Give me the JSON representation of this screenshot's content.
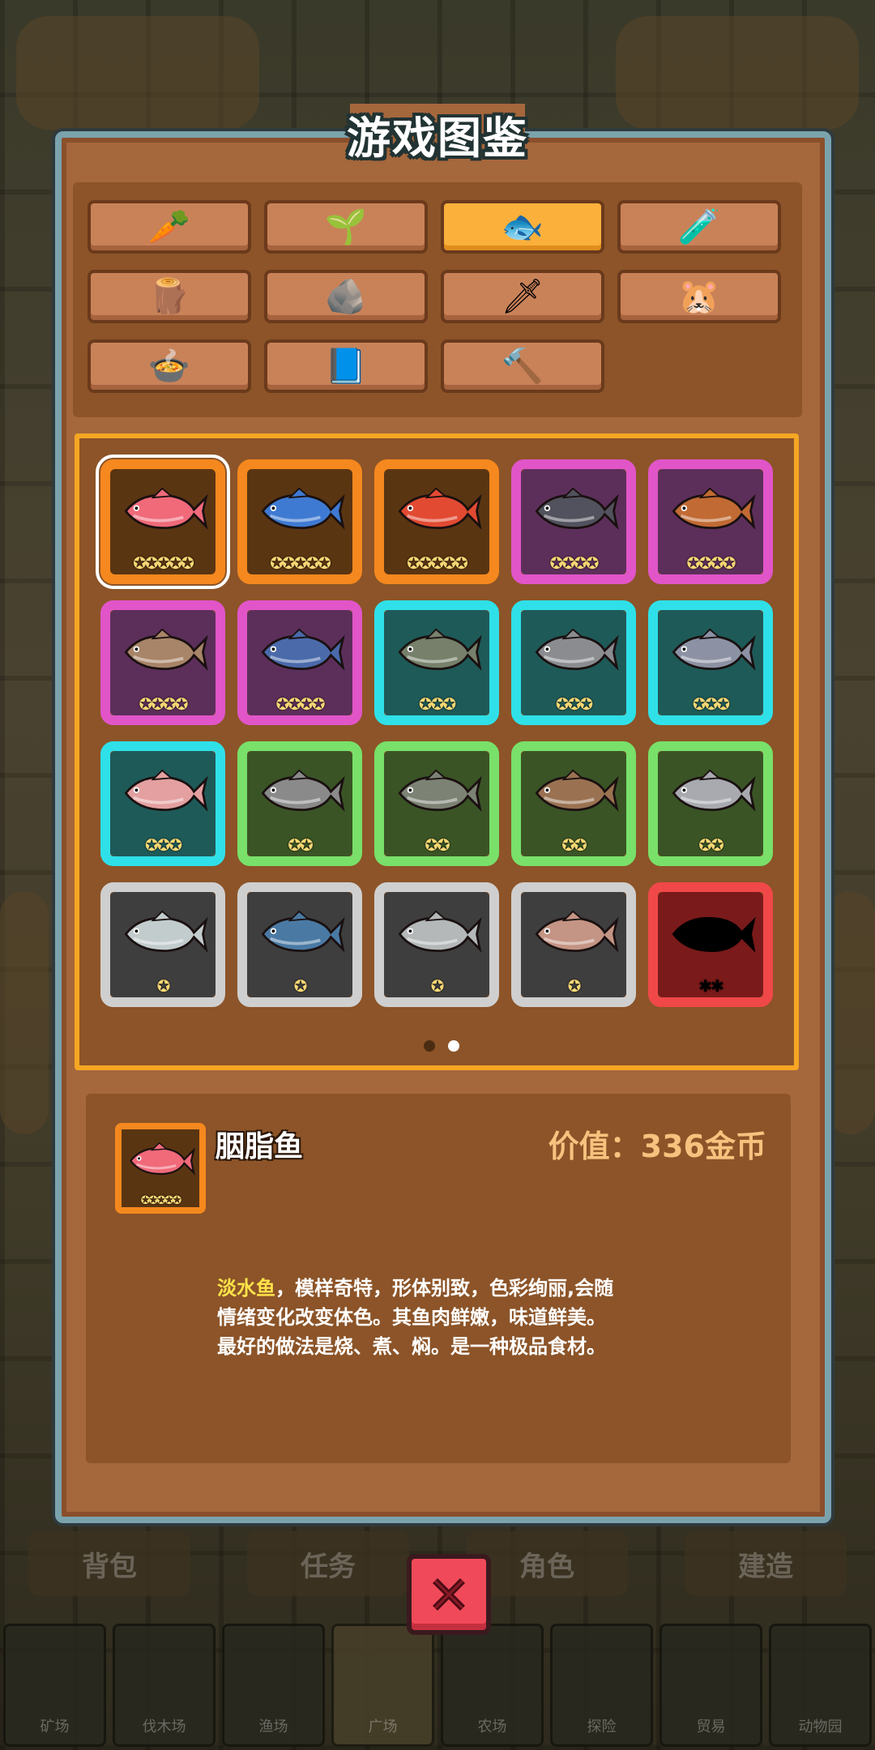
{
  "title": "游戏图鉴",
  "categories": [
    {
      "name": "vegetable",
      "icon": "🥕",
      "selected": false
    },
    {
      "name": "seeds",
      "icon": "🌱",
      "selected": false
    },
    {
      "name": "fish",
      "icon": "🐟",
      "selected": true
    },
    {
      "name": "potion",
      "icon": "🧪",
      "selected": false
    },
    {
      "name": "wood",
      "icon": "🪵",
      "selected": false
    },
    {
      "name": "ore",
      "icon": "🪨",
      "selected": false
    },
    {
      "name": "sword",
      "icon": "🗡",
      "selected": false
    },
    {
      "name": "animal",
      "icon": "🐹",
      "selected": false
    },
    {
      "name": "dish",
      "icon": "🍲",
      "selected": false
    },
    {
      "name": "book",
      "icon": "📘",
      "selected": false
    },
    {
      "name": "hammer",
      "icon": "🔨",
      "selected": false
    }
  ],
  "fishes": [
    {
      "rarity": "orange",
      "stars": "✪✪✪✪✪",
      "color": "#f06a7a",
      "selected": true
    },
    {
      "rarity": "orange",
      "stars": "✪✪✪✪✪",
      "color": "#3f7ad2"
    },
    {
      "rarity": "orange",
      "stars": "✪✪✪✪✪",
      "color": "#e24a32"
    },
    {
      "rarity": "pink",
      "stars": "✪✪✪✪",
      "color": "#52525e"
    },
    {
      "rarity": "pink",
      "stars": "✪✪✪✪",
      "color": "#c16a34"
    },
    {
      "rarity": "pink",
      "stars": "✪✪✪✪",
      "color": "#a88468"
    },
    {
      "rarity": "pink",
      "stars": "✪✪✪✪",
      "color": "#4a6aaa"
    },
    {
      "rarity": "cyan",
      "stars": "✪✪✪",
      "color": "#76806a"
    },
    {
      "rarity": "cyan",
      "stars": "✪✪✪",
      "color": "#8a8c90"
    },
    {
      "rarity": "cyan",
      "stars": "✪✪✪",
      "color": "#8c92a4"
    },
    {
      "rarity": "cyan",
      "stars": "✪✪✪",
      "color": "#e4a0a0"
    },
    {
      "rarity": "green",
      "stars": "✪✪",
      "color": "#8a8a8a"
    },
    {
      "rarity": "green",
      "stars": "✪✪",
      "color": "#7c8274"
    },
    {
      "rarity": "green",
      "stars": "✪✪",
      "color": "#9a7252"
    },
    {
      "rarity": "green",
      "stars": "✪✪",
      "color": "#a8aab0"
    },
    {
      "rarity": "gray",
      "stars": "✪",
      "color": "#c2cccc"
    },
    {
      "rarity": "gray",
      "stars": "✪",
      "color": "#4a7aa4"
    },
    {
      "rarity": "gray",
      "stars": "✪",
      "color": "#b4b8b8"
    },
    {
      "rarity": "gray",
      "stars": "✪",
      "color": "#c49484"
    },
    {
      "rarity": "red",
      "stars": "✪✪",
      "color": "#000000",
      "locked": true
    }
  ],
  "pages": {
    "total": 2,
    "current": 2
  },
  "detail": {
    "name": "胭脂鱼",
    "price": "价值：336金币",
    "desc_highlight": "淡水鱼",
    "desc_line1_rest": "，模样奇特，形体别致，色彩绚丽,会随",
    "desc_line2": "情绪变化改变体色。其鱼肉鲜嫩，味道鲜美。",
    "desc_line3": "最好的做法是烧、煮、焖。是一种极品食材。",
    "stars": "✪✪✪✪✪",
    "color": "#f06a7a"
  },
  "background_tabs": [
    "背包",
    "任务",
    "角色",
    "建造"
  ],
  "dock": [
    "矿场",
    "伐木场",
    "渔场",
    "广场",
    "农场",
    "探险",
    "贸易",
    "动物园"
  ],
  "close_icon": "close-icon"
}
